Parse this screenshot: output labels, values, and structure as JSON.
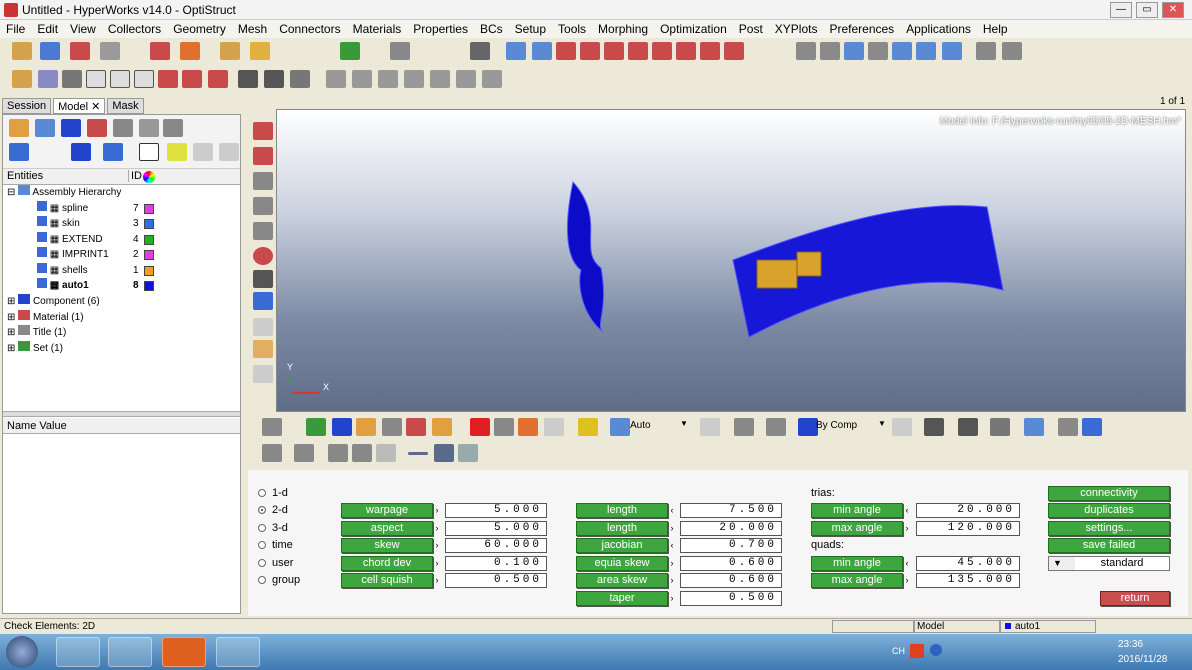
{
  "window": {
    "title": "Untitled - HyperWorks v14.0 - OptiStruct",
    "min": "—",
    "max": "▭",
    "close": "✕"
  },
  "menu": [
    "File",
    "Edit",
    "View",
    "Collectors",
    "Geometry",
    "Mesh",
    "Connectors",
    "Materials",
    "Properties",
    "BCs",
    "Setup",
    "Tools",
    "Morphing",
    "Optimization",
    "Post",
    "XYPlots",
    "Preferences",
    "Applications",
    "Help"
  ],
  "page_indicator": "1 of 1",
  "tabs": [
    "Session",
    "Model",
    "Mask"
  ],
  "browser": {
    "col_entities": "Entities",
    "col_id": "ID",
    "root": "Assembly Hierarchy",
    "comps": [
      {
        "name": "spline",
        "id": "7",
        "color": "#e040e0"
      },
      {
        "name": "skin",
        "id": "3",
        "color": "#3070e0"
      },
      {
        "name": "EXTEND",
        "id": "4",
        "color": "#20b020"
      },
      {
        "name": "IMPRINT1",
        "id": "2",
        "color": "#e040e0"
      },
      {
        "name": "shells",
        "id": "1",
        "color": "#f0a020"
      },
      {
        "name": "auto1",
        "id": "8",
        "color": "#1010e0"
      }
    ],
    "groups": [
      "Component (6)",
      "Material (1)",
      "Title (1)",
      "Set (1)"
    ],
    "props_header": "Name Value"
  },
  "viewport": {
    "model_info": "Model Info: F:/Hyperwoks-run/my05/05-2D-MESH.hm*",
    "axis_x": "X",
    "axis_y": "Y",
    "axis_z": "Z"
  },
  "vis_toolbar": {
    "auto": "Auto",
    "by_comp": "By Comp"
  },
  "panel": {
    "radios": [
      "1-d",
      "2-d",
      "3-d",
      "time",
      "user",
      "group"
    ],
    "col1": [
      {
        "label": "warpage",
        "value": "5.000"
      },
      {
        "label": "aspect",
        "value": "5.000"
      },
      {
        "label": "skew",
        "value": "60.000"
      },
      {
        "label": "chord dev",
        "value": "0.100"
      },
      {
        "label": "cell squish",
        "value": "0.500"
      }
    ],
    "col2": [
      {
        "label": "length",
        "value": "7.500"
      },
      {
        "label": "length",
        "value": "20.000"
      },
      {
        "label": "jacobian",
        "value": "0.700"
      },
      {
        "label": "equia skew",
        "value": "0.600"
      },
      {
        "label": "area skew",
        "value": "0.600"
      },
      {
        "label": "taper",
        "value": "0.500"
      }
    ],
    "trias_label": "trias:",
    "quads_label": "quads:",
    "trias": [
      {
        "label": "min angle",
        "value": "20.000"
      },
      {
        "label": "max angle",
        "value": "120.000"
      }
    ],
    "quads": [
      {
        "label": "min angle",
        "value": "45.000"
      },
      {
        "label": "max angle",
        "value": "135.000"
      }
    ],
    "actions": [
      "connectivity",
      "duplicates",
      "settings...",
      "save failed"
    ],
    "standard": "standard",
    "return": "return"
  },
  "status": {
    "left": "Check Elements: 2D",
    "model": "Model",
    "comp": "auto1"
  },
  "taskbar": {
    "time": "23:36",
    "date": "2016/11/28",
    "lang": "CH"
  }
}
